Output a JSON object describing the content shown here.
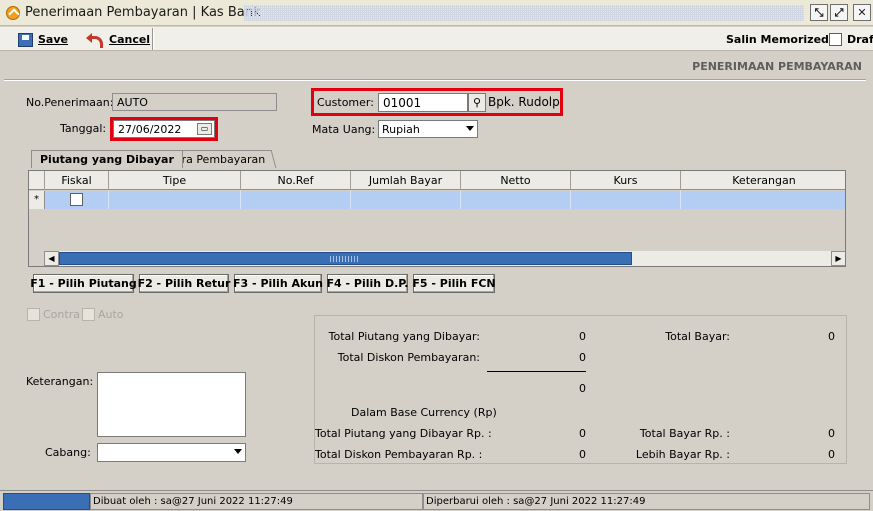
{
  "window": {
    "title": "Penerimaan Pembayaran | Kas Bank"
  },
  "toolbar": {
    "save_label": "Save",
    "cancel_label": "Cancel",
    "salin_label": "Salin Memorized",
    "draft_label": "Draft"
  },
  "header": {
    "section_title": "PENERIMAAN PEMBAYARAN"
  },
  "form": {
    "no_label": "No.Penerimaan:",
    "no_value": "AUTO",
    "tanggal_label": "Tanggal:",
    "tanggal_value": "27/06/2022",
    "customer_label": "Customer:",
    "customer_code": "01001",
    "customer_name": "Bpk. Rudolp",
    "currency_label": "Mata Uang:",
    "currency_value": "Rupiah"
  },
  "tabs": [
    {
      "label": "Piutang yang Dibayar"
    },
    {
      "label": "Cara Pembayaran"
    }
  ],
  "grid": {
    "columns": [
      "Fiskal",
      "Tipe",
      "No.Ref",
      "Jumlah Bayar",
      "Netto",
      "Kurs",
      "Keterangan"
    ],
    "row_marker": "*"
  },
  "function_buttons": [
    "F1 - Pilih Piutang",
    "F2 - Pilih Retur",
    "F3 - Pilih Akun",
    "F4 - Pilih D.P.",
    "F5 - Pilih FCN"
  ],
  "options": {
    "contra_label": "Contra",
    "auto_label": "Auto"
  },
  "notes": {
    "keterangan_label": "Keterangan:",
    "cabang_label": "Cabang:"
  },
  "summary": {
    "total_piutang_label": "Total Piutang yang Dibayar:",
    "total_piutang_value": "0",
    "total_diskon_label": "Total Diskon Pembayaran:",
    "total_diskon_value": "0",
    "subtotal_value": "0",
    "total_bayar_label": "Total Bayar:",
    "total_bayar_value": "0",
    "base_currency_label": "Dalam Base Currency (Rp)",
    "total_piutang_rp_label": "Total Piutang yang Dibayar Rp. :",
    "total_piutang_rp_value": "0",
    "total_diskon_rp_label": "Total Diskon Pembayaran Rp. :",
    "total_diskon_rp_value": "0",
    "total_bayar_rp_label": "Total Bayar Rp. :",
    "total_bayar_rp_value": "0",
    "lebih_bayar_rp_label": "Lebih Bayar Rp. :",
    "lebih_bayar_rp_value": "0"
  },
  "status": {
    "created": "Dibuat oleh : sa@27 Juni 2022  11:27:49",
    "updated": "Diperbarui oleh : sa@27 Juni 2022  11:27:49"
  },
  "colors": {
    "highlight_box": "#e00010",
    "grid_row": "#b3cdf3",
    "scroll_thumb": "#3a6fb5"
  }
}
